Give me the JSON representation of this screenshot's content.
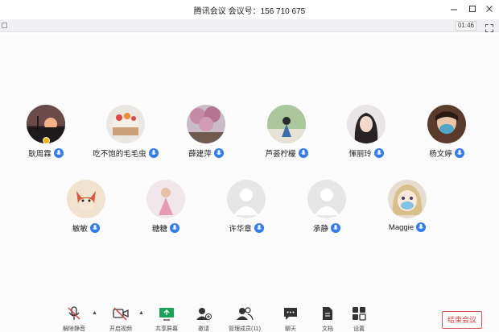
{
  "window": {
    "title": "腾讯会议  会议号：156 710 675"
  },
  "infobar": {
    "timer": "01:46"
  },
  "participants": [
    {
      "name": "耿周霖",
      "avatar": "sunset-silhouette-avatar",
      "host": true
    },
    {
      "name": "吃不饱的毛毛虫",
      "avatar": "cake-avatar",
      "host": false
    },
    {
      "name": "薛建萍",
      "avatar": "cherry-blossom-avatar",
      "host": false
    },
    {
      "name": "芦荟柠檬",
      "avatar": "girl-in-garden-avatar",
      "host": false
    },
    {
      "name": "惲丽玲",
      "avatar": "girl-photo-avatar",
      "host": false
    },
    {
      "name": "杨文婷",
      "avatar": "masked-selfie-avatar",
      "host": false
    },
    {
      "name": "敏敏",
      "avatar": "cartoon-fox-avatar",
      "host": false
    },
    {
      "name": "糖糖",
      "avatar": "pink-dress-girl-avatar",
      "host": false
    },
    {
      "name": "许华章",
      "avatar": "default-person-avatar",
      "host": false
    },
    {
      "name": "承静",
      "avatar": "default-person-avatar",
      "host": false
    },
    {
      "name": "Maggie",
      "avatar": "anime-girl-mask-avatar",
      "host": false
    }
  ],
  "toolbar": {
    "unmute": "解除静音",
    "video": "开启视频",
    "share": "共享屏幕",
    "invite": "邀请",
    "members": "管理成员(11)",
    "chat": "聊天",
    "docs": "文档",
    "settings": "设置",
    "end": "结束会议"
  },
  "colors": {
    "accent": "#2f7cf6",
    "danger": "#e03a3a",
    "share_green": "#1aa15a"
  }
}
